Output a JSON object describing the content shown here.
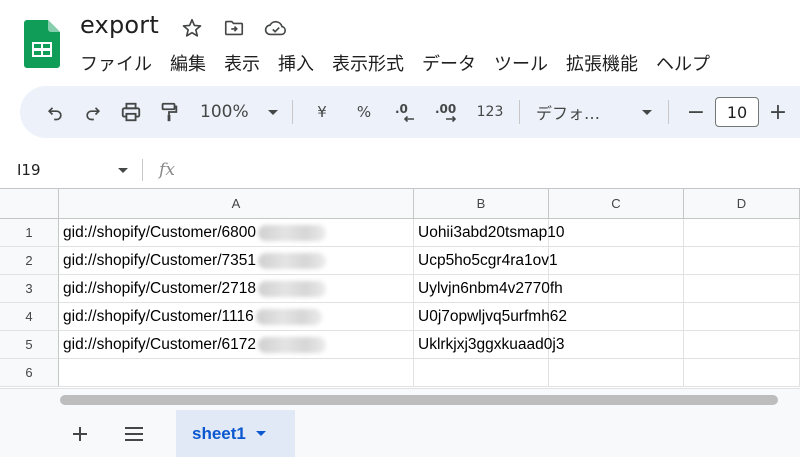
{
  "app": {
    "title": "export",
    "brand_color": "#0f9d58",
    "accent_color": "#0b57d0"
  },
  "title_icons": [
    "star-icon",
    "move-to-folder-icon",
    "cloud-saved-icon"
  ],
  "menu": [
    "ファイル",
    "編集",
    "表示",
    "挿入",
    "表示形式",
    "データ",
    "ツール",
    "拡張機能",
    "ヘルプ"
  ],
  "toolbar": {
    "zoom": "100%",
    "currency": "¥",
    "percent": "%",
    "decrease_decimal": ".0",
    "increase_decimal": ".00",
    "number_format": "123",
    "font": "デフォ…",
    "font_size": "10",
    "minus": "−",
    "plus": "+"
  },
  "formula_bar": {
    "cell_ref": "I19",
    "fx": "fx",
    "value": ""
  },
  "grid": {
    "columns": [
      "A",
      "B",
      "C",
      "D"
    ],
    "rows": [
      {
        "num": "1",
        "a": "gid://shopify/Customer/6800",
        "b": "Uohii3abd20tsmap10"
      },
      {
        "num": "2",
        "a": "gid://shopify/Customer/7351",
        "b": "Ucp5ho5cgr4ra1ov1"
      },
      {
        "num": "3",
        "a": "gid://shopify/Customer/2718",
        "b": "Uylvjn6nbm4v2770fh"
      },
      {
        "num": "4",
        "a": "gid://shopify/Customer/1116",
        "b": "U0j7opwljvq5urfmh62"
      },
      {
        "num": "5",
        "a": "gid://shopify/Customer/6172",
        "b": "Uklrkjxj3ggxkuaad0j3"
      },
      {
        "num": "6",
        "a": "",
        "b": ""
      }
    ]
  },
  "sheets": {
    "active": "sheet1"
  }
}
